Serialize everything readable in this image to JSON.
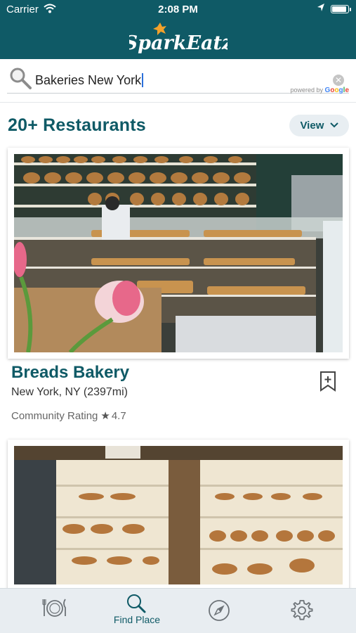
{
  "status_bar": {
    "carrier": "Carrier",
    "time": "2:08 PM"
  },
  "header": {
    "brand": "SparkEatz"
  },
  "search": {
    "query": "Bakeries New York",
    "powered_by": "powered by",
    "powered_brand": "Google"
  },
  "results": {
    "title": "20+ Restaurants",
    "view_label": "View"
  },
  "restaurants": [
    {
      "name": "Breads Bakery",
      "location": "New York, NY (2397mi)",
      "rating_label": "Community Rating",
      "rating": "4.7"
    }
  ],
  "tabbar": {
    "tabs": [
      {
        "icon": "plate-icon",
        "label": ""
      },
      {
        "icon": "search-icon",
        "label": "Find Place"
      },
      {
        "icon": "compass-icon",
        "label": ""
      },
      {
        "icon": "gear-icon",
        "label": ""
      }
    ]
  },
  "colors": {
    "brand": "#0f5a66",
    "accent_star": "#f2a12b"
  }
}
